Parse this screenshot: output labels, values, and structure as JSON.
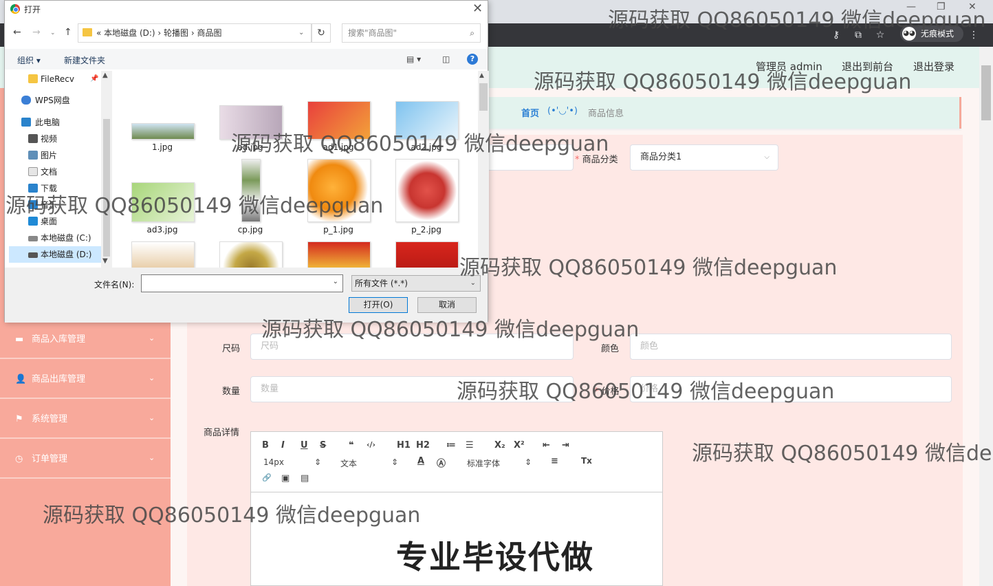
{
  "browser": {
    "incognito_label": "无痕模式",
    "icons": [
      "key-icon",
      "translate-icon",
      "star-icon",
      "incognito-icon",
      "more-icon"
    ]
  },
  "header": {
    "user": "管理员 admin",
    "front": "退出到前台",
    "logout": "退出登录"
  },
  "breadcrumb": {
    "home": "首页",
    "face": "(•'◡'•)",
    "current": "商品信息"
  },
  "sidebar": {
    "items": [
      {
        "label": "商品入库管理",
        "icon": "box-icon"
      },
      {
        "label": "商品出库管理",
        "icon": "user-icon"
      },
      {
        "label": "系统管理",
        "icon": "flag-icon"
      },
      {
        "label": "订单管理",
        "icon": "clock-icon"
      }
    ]
  },
  "form": {
    "category_label": "商品分类",
    "category_value": "商品分类1",
    "size_label": "尺码",
    "size_placeholder": "尺码",
    "color_label": "颜色",
    "color_placeholder": "颜色",
    "qty_label": "数量",
    "qty_placeholder": "数量",
    "price_label": "价格",
    "price_placeholder": "价格",
    "detail_label": "商品详情"
  },
  "editor": {
    "font_size": "14px",
    "text_type": "文本",
    "font_family": "标准字体",
    "buttons": [
      "B",
      "I",
      "U",
      "S",
      "❝",
      "‹/›",
      "H1",
      "H2",
      "≔",
      "☰",
      "X₂",
      "X²",
      "⇤",
      "⇥",
      "A",
      "Ⓐ",
      "≡",
      "Tx",
      "🔗",
      "▣",
      "▤"
    ]
  },
  "promo_text": "专业毕设代做",
  "dialog": {
    "title": "打开",
    "path": "« 本地磁盘 (D:)  ›  轮播图  ›  商品图",
    "search_placeholder": "搜索\"商品图\"",
    "organize": "组织 ▾",
    "new_folder": "新建文件夹",
    "nav": [
      {
        "label": "FileRecv",
        "icon": "folder-icon"
      },
      {
        "label": "WPS网盘",
        "icon": "cloud-icon"
      },
      {
        "label": "此电脑",
        "icon": "computer-icon"
      },
      {
        "label": "视频",
        "icon": "video-icon"
      },
      {
        "label": "图片",
        "icon": "picture-icon"
      },
      {
        "label": "文档",
        "icon": "document-icon"
      },
      {
        "label": "下载",
        "icon": "download-icon"
      },
      {
        "label": "音乐",
        "icon": "music-icon"
      },
      {
        "label": "桌面",
        "icon": "desktop-icon"
      },
      {
        "label": "本地磁盘 (C:)",
        "icon": "drive-icon"
      },
      {
        "label": "本地磁盘 (D:)",
        "icon": "drive-icon"
      }
    ],
    "files": [
      {
        "name": "1.jpg"
      },
      {
        "name": "ad.jpg"
      },
      {
        "name": "ad1.jpg"
      },
      {
        "name": "ad2.jpg"
      },
      {
        "name": "ad3.jpg"
      },
      {
        "name": "cp.jpg"
      },
      {
        "name": "p_1.jpg"
      },
      {
        "name": "p_2.jpg"
      },
      {
        "name": ""
      },
      {
        "name": ""
      },
      {
        "name": ""
      },
      {
        "name": ""
      }
    ],
    "filename_label": "文件名(N):",
    "filetype": "所有文件 (*.*)",
    "open_btn": "打开(O)",
    "cancel_btn": "取消"
  },
  "watermarks": [
    "源码获取 QQ86050149 微信deepguan",
    "源码获取 QQ86050149 微信deepguan",
    "源码获取 QQ86050149 微信deepguan",
    "源码获取 QQ86050149 微信deepguan",
    "源码获取 QQ86050149 微信deepguan",
    "源码获取 QQ86050149 微信deepguan",
    "源码获取 QQ86050149 微信deepguan",
    "源码获取 QQ86050149 微信dee",
    "源码获取 QQ86050149 微信deepguan"
  ],
  "colors": {
    "sidebar": "#f8a99b",
    "header": "#e3f3ee",
    "main": "#fee8e5",
    "link": "#2a7fd4"
  }
}
